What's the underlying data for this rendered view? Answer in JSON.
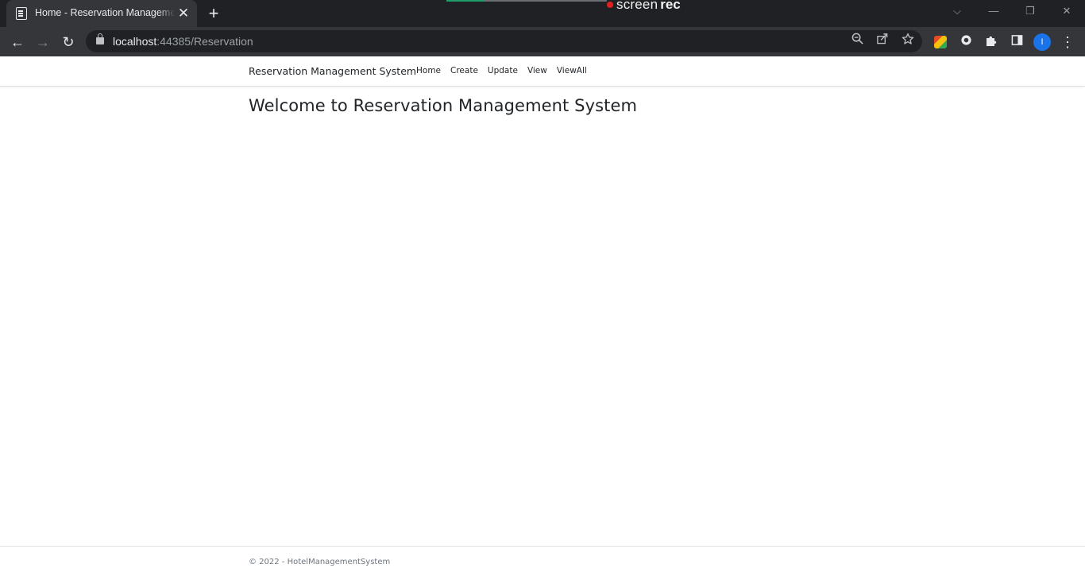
{
  "browser": {
    "tab_title": "Home - Reservation Management System",
    "tab_close": "✕",
    "new_tab": "+",
    "recorder": {
      "part1": "screen",
      "part2": "rec"
    },
    "window_controls": {
      "tabsearch": "⌵",
      "minimize": "—",
      "restore": "❐",
      "close": "✕"
    },
    "nav": {
      "back": "←",
      "forward": "→",
      "reload": "↻"
    },
    "url_host": "localhost",
    "url_rest": ":44385/Reservation",
    "profile_initial": "I",
    "icons": [
      "zoom-icon",
      "share-icon",
      "bookmark-star-icon",
      "extension-colorful-icon",
      "extension-circle-icon",
      "extensions-puzzle-icon",
      "side-panel-icon"
    ]
  },
  "navbar": {
    "brand": "Reservation Management System",
    "links": [
      "Home",
      "Create",
      "Update",
      "View",
      "ViewAll"
    ]
  },
  "main": {
    "heading": "Welcome to Reservation Management System"
  },
  "footer": {
    "text": "© 2022 - HotelManagementSystem"
  }
}
